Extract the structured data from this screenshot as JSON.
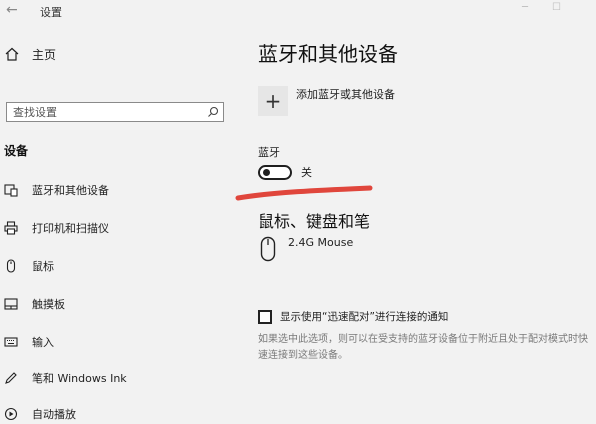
{
  "window": {
    "title": "设置"
  },
  "sidebar": {
    "home_label": "主页",
    "search_placeholder": "查找设置",
    "section_header": "设备",
    "items": [
      {
        "label": "蓝牙和其他设备",
        "icon": "bluetooth-devices-icon"
      },
      {
        "label": "打印机和扫描仪",
        "icon": "printer-icon"
      },
      {
        "label": "鼠标",
        "icon": "mouse-icon"
      },
      {
        "label": "触摸板",
        "icon": "touchpad-icon"
      },
      {
        "label": "输入",
        "icon": "keyboard-icon"
      },
      {
        "label": "笔和 Windows Ink",
        "icon": "pen-icon"
      },
      {
        "label": "自动播放",
        "icon": "autoplay-icon"
      }
    ]
  },
  "main": {
    "title": "蓝牙和其他设备",
    "add_device_label": "添加蓝牙或其他设备",
    "bluetooth_label": "蓝牙",
    "bluetooth_state": "关",
    "mouse_section_title": "鼠标、键盘和笔",
    "devices": [
      {
        "name": "2.4G Mouse",
        "icon": "mouse-device-icon"
      }
    ],
    "swift_pair_label": "显示使用“迅速配对”进行连接的通知",
    "swift_pair_description": "如果选中此选项，则可以在受支持的蓝牙设备位于附近且处于配对模式时快速连接到这些设备。",
    "bluetooth_on": false,
    "swift_pair_checked": false
  },
  "colors": {
    "background": "#f2f2f2",
    "annotation_red": "#e0463c"
  }
}
